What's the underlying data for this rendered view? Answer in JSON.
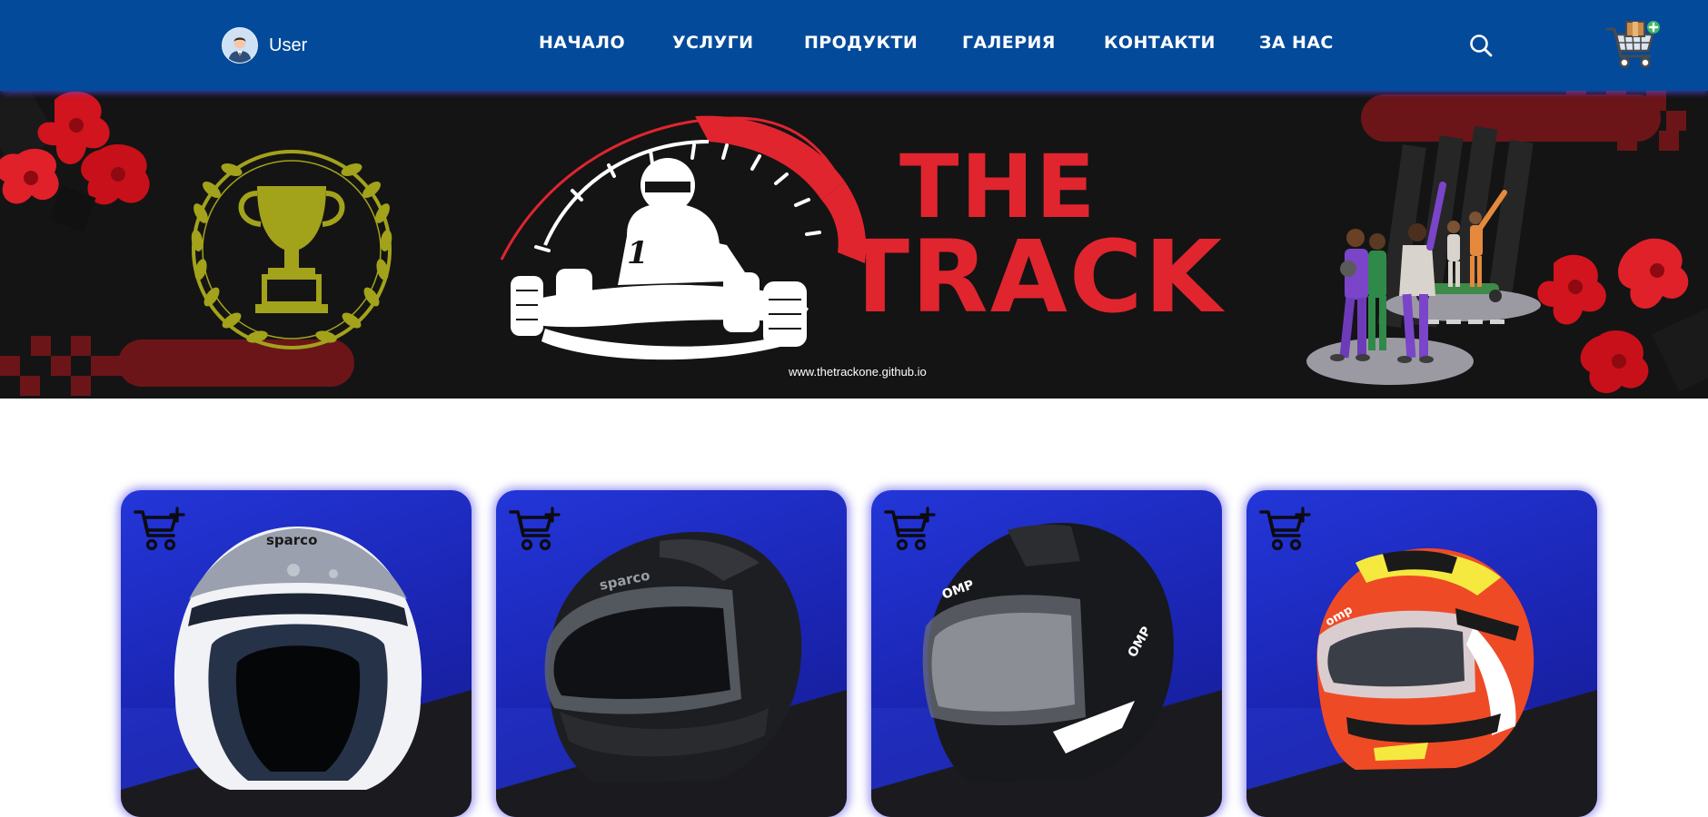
{
  "header": {
    "user_label": "User",
    "nav": [
      "НАЧАЛО",
      "УСЛУГИ",
      "ПРОДУКТИ",
      "ГАЛЕРИЯ",
      "КОНТАКТИ",
      "ЗА НАС"
    ],
    "icons": {
      "search": "search-icon",
      "cart": "cart-icon",
      "avatar": "user-avatar-icon"
    },
    "colors": {
      "bar": "#034a9b",
      "text": "#ffffff"
    }
  },
  "hero": {
    "brand_line1": "THE",
    "brand_line2": "TRACK",
    "url": "www.thetrackone.github.io",
    "colors": {
      "background": "#141414",
      "accent": "#e0252f",
      "trophy": "#a3a21b"
    }
  },
  "products": [
    {
      "brand_mark": "sparco",
      "style": "open-face white helmet"
    },
    {
      "brand_mark": "sparco",
      "style": "full-face matte black helmet"
    },
    {
      "brand_mark": "OMP",
      "style": "full-face black helmet"
    },
    {
      "brand_mark": "omp",
      "style": "full-face red graphic helmet"
    }
  ],
  "card_icon": "add-to-cart-icon",
  "card_colors": {
    "blue": "#2336d8",
    "dark": "#1b1b1f"
  }
}
